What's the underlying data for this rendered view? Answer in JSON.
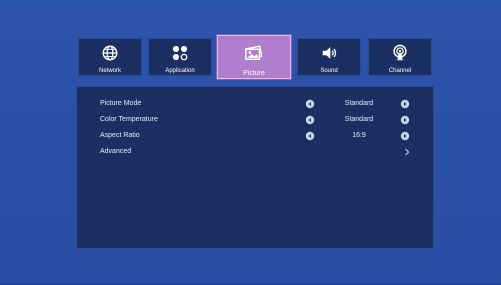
{
  "tabs": [
    {
      "id": "network",
      "label": "Network",
      "icon": "globe-icon",
      "active": false
    },
    {
      "id": "application",
      "label": "Application",
      "icon": "apps-icon",
      "active": false
    },
    {
      "id": "picture",
      "label": "Picture",
      "icon": "picture-icon",
      "active": true
    },
    {
      "id": "sound",
      "label": "Sound",
      "icon": "speaker-icon",
      "active": false
    },
    {
      "id": "channel",
      "label": "Channel",
      "icon": "antenna-icon",
      "active": false
    }
  ],
  "settings": [
    {
      "label": "Picture Mode",
      "value": "Standard"
    },
    {
      "label": "Color Temperature",
      "value": "Standard"
    },
    {
      "label": "Aspect Ratio",
      "value": "16:9"
    },
    {
      "label": "Advanced",
      "value": ""
    }
  ],
  "colors": {
    "background": "#2a50a8",
    "panel": "#1b2f62",
    "active_tab": "#b07ecc",
    "text": "#ffffff"
  }
}
